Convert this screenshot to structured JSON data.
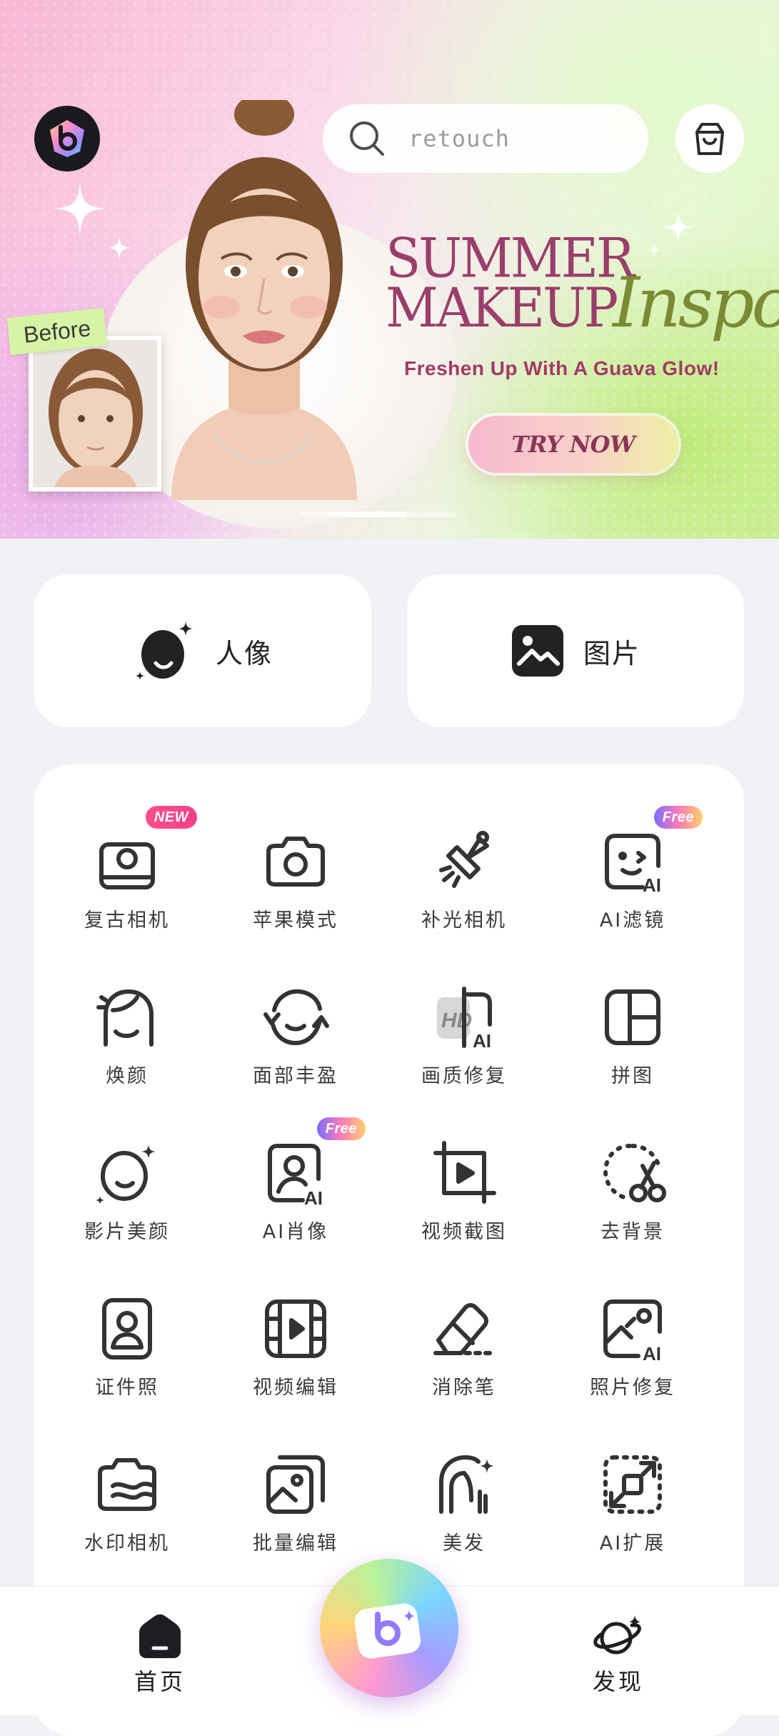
{
  "banner": {
    "search_placeholder": "retouch",
    "headline_line1": "SUMMER",
    "headline_line2": "MAKEUP",
    "headline_script": "Inspo",
    "subline": "Freshen Up With A Guava Glow!",
    "cta_label": "TRY NOW",
    "before_tag": "Before"
  },
  "modes": {
    "portrait_label": "人像",
    "picture_label": "图片"
  },
  "tools": [
    {
      "label": "复古相机",
      "icon": "retro-camera-icon",
      "badge": "NEW"
    },
    {
      "label": "苹果模式",
      "icon": "camera-icon",
      "badge": ""
    },
    {
      "label": "补光相机",
      "icon": "fill-light-icon",
      "badge": ""
    },
    {
      "label": "AI滤镜",
      "icon": "ai-filter-icon",
      "badge": "Free"
    },
    {
      "label": "焕颜",
      "icon": "face-glow-icon",
      "badge": ""
    },
    {
      "label": "面部丰盈",
      "icon": "face-plump-icon",
      "badge": ""
    },
    {
      "label": "画质修复",
      "icon": "hd-enhance-icon",
      "badge": ""
    },
    {
      "label": "拼图",
      "icon": "collage-icon",
      "badge": ""
    },
    {
      "label": "影片美颜",
      "icon": "video-beauty-icon",
      "badge": ""
    },
    {
      "label": "AI肖像",
      "icon": "ai-portrait-icon",
      "badge": "Free"
    },
    {
      "label": "视频截图",
      "icon": "video-crop-icon",
      "badge": ""
    },
    {
      "label": "去背景",
      "icon": "remove-bg-icon",
      "badge": ""
    },
    {
      "label": "证件照",
      "icon": "id-photo-icon",
      "badge": ""
    },
    {
      "label": "视频编辑",
      "icon": "video-edit-icon",
      "badge": ""
    },
    {
      "label": "消除笔",
      "icon": "eraser-icon",
      "badge": ""
    },
    {
      "label": "照片修复",
      "icon": "photo-repair-icon",
      "badge": ""
    },
    {
      "label": "水印相机",
      "icon": "watermark-camera-icon",
      "badge": ""
    },
    {
      "label": "批量编辑",
      "icon": "batch-edit-icon",
      "badge": ""
    },
    {
      "label": "美发",
      "icon": "hair-icon",
      "badge": ""
    },
    {
      "label": "AI扩展",
      "icon": "ai-expand-icon",
      "badge": ""
    }
  ],
  "nav": {
    "home_label": "首页",
    "discover_label": "发现"
  }
}
